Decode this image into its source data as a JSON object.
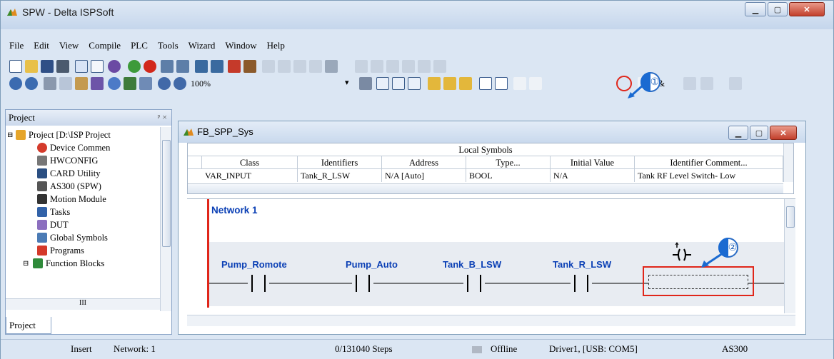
{
  "app": {
    "title": "SPW - Delta ISPSoft"
  },
  "menu": [
    "File",
    "Edit",
    "View",
    "Compile",
    "PLC",
    "Tools",
    "Wizard",
    "Window",
    "Help"
  ],
  "toolbar": {
    "zoom": "100%",
    "callout1": "①",
    "callout2": "②",
    "amp": "&"
  },
  "project_pane": {
    "title": "Project",
    "pin": "ᵖ ×",
    "tab": "Project",
    "tree": [
      "Project [D:\\ISP Project",
      "Device Commen",
      "HWCONFIG",
      "CARD Utility",
      "AS300  (SPW)",
      "Motion Module",
      "Tasks",
      "DUT",
      "Global Symbols",
      "Programs",
      "Function Blocks"
    ],
    "scroll_h_label": "III"
  },
  "editor": {
    "title": "FB_SPP_Sys",
    "local_symbols": "Local Symbols",
    "columns": [
      "Class",
      "Identifiers",
      "Address",
      "Type...",
      "Initial Value",
      "Identifier Comment..."
    ],
    "row": [
      "VAR_INPUT",
      "Tank_R_LSW",
      "N/A [Auto]",
      "BOOL",
      "N/A",
      "Tank RF Level Switch- Low"
    ],
    "network": "Network 1",
    "contacts": [
      "Pump_Romote",
      "Pump_Auto",
      "Tank_B_LSW",
      "Tank_R_LSW"
    ]
  },
  "status": {
    "mode": "Insert",
    "network": "Network: 1",
    "steps": "0/131040 Steps",
    "conn": "Offline",
    "driver": "Driver1, [USB: COM5]",
    "plc": "AS300"
  },
  "colors": {
    "accent": "#0a3fb5",
    "rail": "#e0261a",
    "highlight": "#e0261a"
  }
}
